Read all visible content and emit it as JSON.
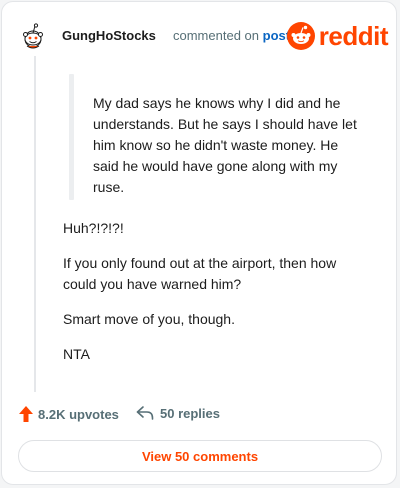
{
  "comment": {
    "username": "GungHoStocks",
    "action_text": "commented on",
    "post_link": "post",
    "brand": "reddit",
    "quote": "My dad says he knows why I did and he understands. But he says I should have let him know so he didn't waste money. He said he would have gone along with my ruse.",
    "paragraphs": [
      "Huh?!?!?!",
      "If you only found out at the airport, then how could you have warned him?",
      "Smart move of you, though.",
      "NTA"
    ]
  },
  "actions": {
    "upvotes": "8.2K upvotes",
    "replies": "50 replies",
    "view_comments": "View 50 comments"
  },
  "icons": {
    "avatar": "snoo-avatar-icon",
    "brand_logo": "reddit-logo-icon",
    "upvote": "upvote-arrow-icon",
    "reply": "reply-arrow-icon"
  },
  "colors": {
    "brand": "#ff4500",
    "link": "#0a65c2",
    "muted": "#576f76"
  }
}
